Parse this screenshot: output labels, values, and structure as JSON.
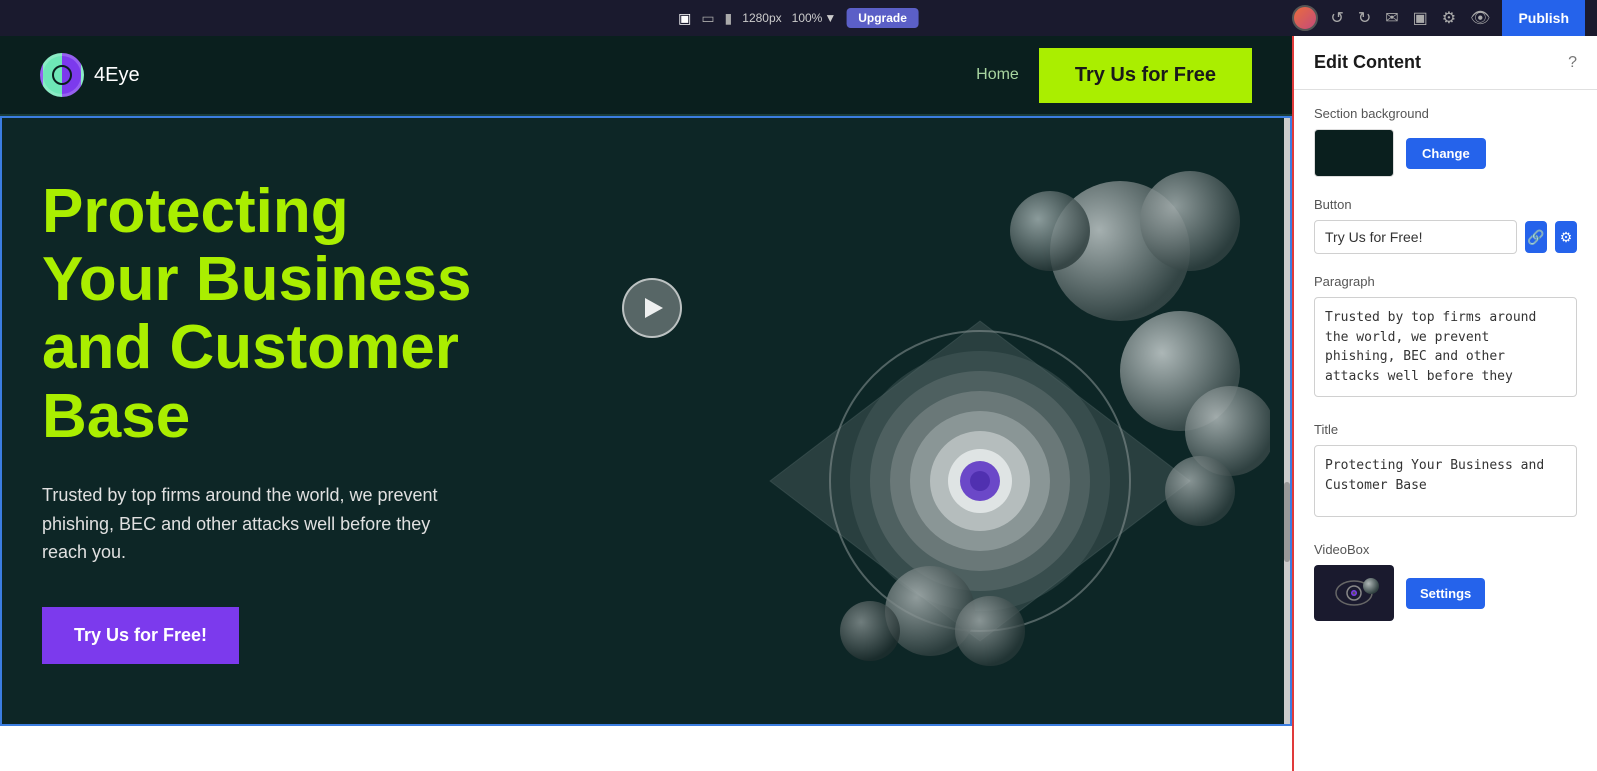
{
  "toolbar": {
    "resolution": "1280px",
    "zoom": "100%",
    "upgrade_label": "Upgrade",
    "publish_label": "Publish"
  },
  "site": {
    "logo_text": "4Eye",
    "nav": {
      "home_label": "Home",
      "cta_label": "Try Us for Free"
    },
    "hero": {
      "title": "Protecting Your Business and Customer Base",
      "paragraph": "Trusted by top firms around the world, we prevent phishing, BEC and other attacks well before they reach you.",
      "cta_label": "Try Us for Free!"
    }
  },
  "panel": {
    "title": "Edit Content",
    "help_label": "?",
    "section_background_label": "Section background",
    "change_label": "Change",
    "button_label": "Button",
    "button_value": "Try Us for Free!",
    "paragraph_label": "Paragraph",
    "paragraph_value": "Trusted by top firms around the world, we prevent phishing, BEC and other attacks well before they",
    "title_label": "Title",
    "title_value": "Protecting Your Business and Customer Base",
    "videobox_label": "VideoBox",
    "settings_label": "Settings"
  }
}
